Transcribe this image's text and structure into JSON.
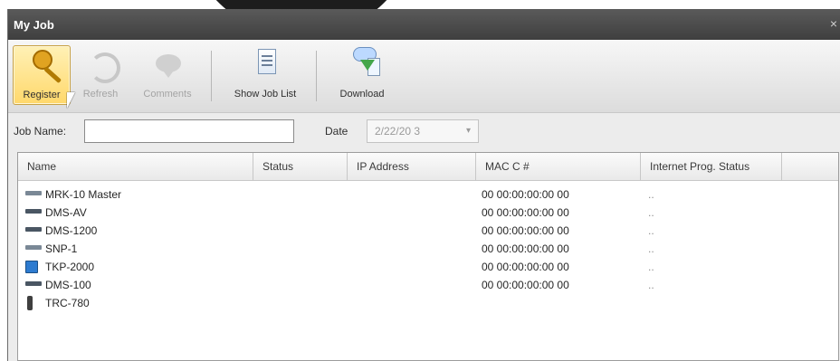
{
  "window": {
    "title": "My Job",
    "close_label": "×"
  },
  "toolbar": {
    "register": "Register",
    "refresh": "Refresh",
    "comments": "Comments",
    "show_job_list": "Show Job List",
    "download": "Download"
  },
  "filters": {
    "job_name_label": "Job Name:",
    "job_name_value": "",
    "date_label": "Date",
    "date_value": "2/22/20 3",
    "date_dropdown_glyph": "▾"
  },
  "table": {
    "headers": [
      "Name",
      "Status",
      "IP Address",
      "MAC C #",
      "Internet Prog. Status"
    ],
    "rows": [
      {
        "name": "MRK-10 Master",
        "status": "",
        "ip": "",
        "mac": "00 00:00:00:00 00",
        "internet": "..",
        "icon": "device-bar-icon"
      },
      {
        "name": "DMS-AV",
        "status": "",
        "ip": "",
        "mac": "00 00:00:00:00 00",
        "internet": "..",
        "icon": "device-bar-icon"
      },
      {
        "name": "DMS-1200",
        "status": "",
        "ip": "",
        "mac": "00 00:00:00:00 00",
        "internet": "..",
        "icon": "device-bar-icon"
      },
      {
        "name": "SNP-1",
        "status": "",
        "ip": "",
        "mac": "00 00:00:00:00 00",
        "internet": "..",
        "icon": "device-bar-icon"
      },
      {
        "name": "TKP-2000",
        "status": "",
        "ip": "",
        "mac": "00 00:00:00:00 00",
        "internet": "..",
        "icon": "touchpanel-icon"
      },
      {
        "name": "DMS-100",
        "status": "",
        "ip": "",
        "mac": "00 00:00:00:00 00",
        "internet": "..",
        "icon": "device-bar-icon"
      },
      {
        "name": "TRC-780",
        "status": "",
        "ip": "",
        "mac": "",
        "internet": "",
        "icon": "remote-icon"
      }
    ]
  }
}
